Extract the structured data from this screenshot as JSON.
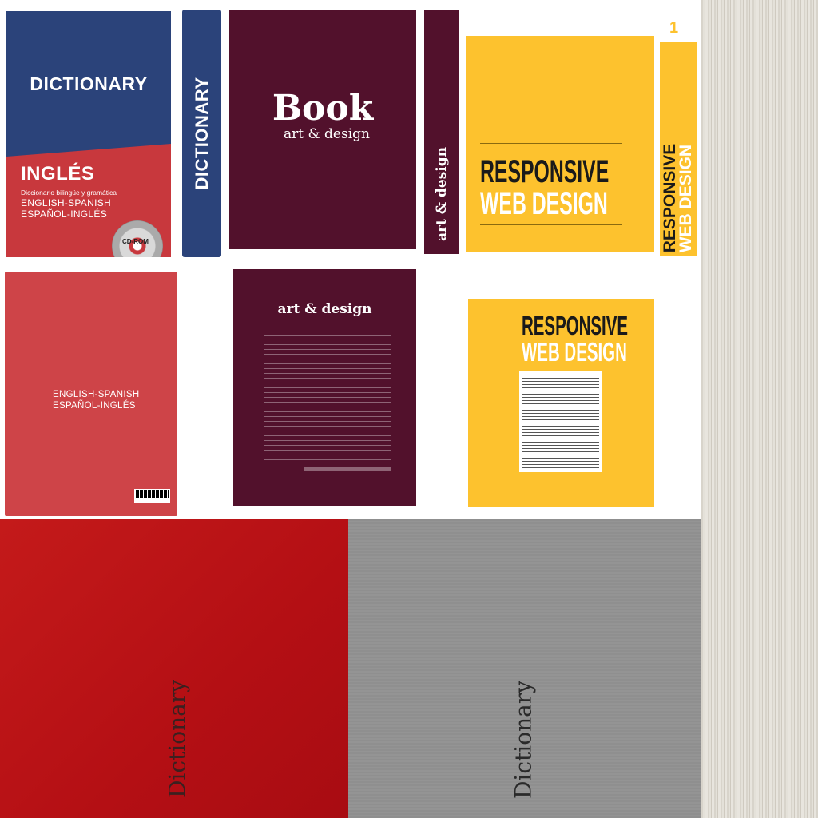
{
  "dictionary": {
    "front_title": "DICTIONARY",
    "front_language": "INGLÉS",
    "front_subtitle": "Diccionario bilingüe y gramática",
    "line1": "ENGLISH-SPANISH",
    "line2": "ESPAÑOL-INGLÉS",
    "cd_label": "CD-ROM",
    "spine_title": "DICTIONARY",
    "texture_word": "Dictionary"
  },
  "book": {
    "front_title": "Book",
    "front_subtitle": "art & design",
    "spine_title": "art & design",
    "back_title": "art & design"
  },
  "rwd": {
    "line1": "RESPONSIVE",
    "line2": "WEB DESIGN",
    "number": "1"
  },
  "colors": {
    "dictionary_blue": "#2b437a",
    "dictionary_red": "#c8383d",
    "book_maroon": "#52112c",
    "rwd_yellow": "#fdc22e",
    "texture_red": "#b40f14",
    "texture_gray": "#919191"
  }
}
